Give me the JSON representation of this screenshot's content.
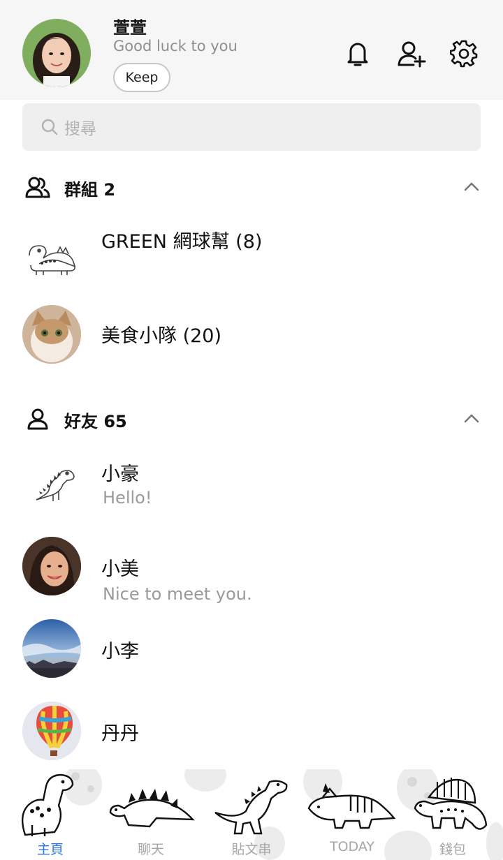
{
  "profile": {
    "name": "萱萱",
    "status_message": "Good luck to you",
    "keep_label": "Keep"
  },
  "header_icons": [
    "bell-icon",
    "add-friend-icon",
    "settings-gear-icon"
  ],
  "search": {
    "placeholder": "搜尋"
  },
  "groups": {
    "title": "群組 2",
    "items": [
      {
        "name": "GREEN 網球幫 (8)",
        "avatar": "dinosaur-sticker"
      },
      {
        "name": "美食小隊 (20)",
        "avatar": "cat-photo"
      }
    ]
  },
  "friends": {
    "title": "好友 65",
    "items": [
      {
        "name": "小豪",
        "message": "Hello!",
        "avatar": "dinosaur-sticker"
      },
      {
        "name": "小美",
        "message": "Nice to meet you.",
        "avatar": "woman-photo"
      },
      {
        "name": "小李",
        "message": "",
        "avatar": "sky-photo"
      },
      {
        "name": "丹丹",
        "message": "",
        "avatar": "hot-air-balloon-photo"
      }
    ]
  },
  "tabs": [
    {
      "label": "主頁",
      "active": true
    },
    {
      "label": "聊天",
      "active": false
    },
    {
      "label": "貼文串",
      "active": false
    },
    {
      "label": "TODAY",
      "active": false
    },
    {
      "label": "錢包",
      "active": false
    }
  ],
  "colors": {
    "accent": "#2b78e4",
    "header_bg": "#f6f6f6",
    "secondary_text": "#9a9a9a"
  }
}
